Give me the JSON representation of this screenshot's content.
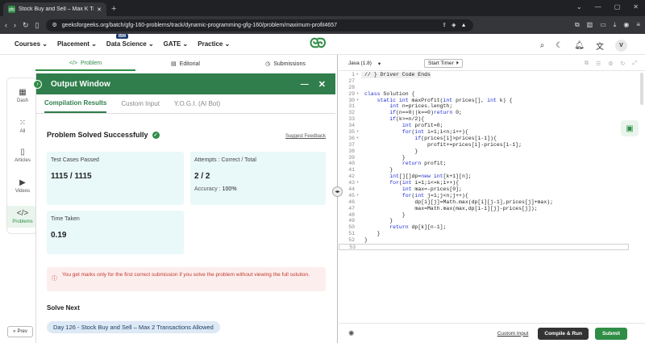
{
  "browser": {
    "tab_title": "Stock Buy and Sell – Max K Tra",
    "new_tab": "+",
    "url": "geeksforgeeks.org/batch/gfg-160-problems/track/dynamic-programming-gfg-160/problem/maximum-profit4657"
  },
  "site": {
    "menu": [
      "Courses",
      "Placement",
      "Data Science",
      "GATE",
      "Practice"
    ],
    "ibm_badge": "IBM",
    "logo": "GG",
    "avatar": "V"
  },
  "problem_tabs": [
    "Problem",
    "Editorial",
    "Submissions"
  ],
  "left_nav": [
    "Dash",
    "All",
    "Articles",
    "Videos",
    "Problems"
  ],
  "prev_label": "Prev",
  "output": {
    "title": "Output Window",
    "tabs": [
      "Compilation Results",
      "Custom Input",
      "Y.O.G.I. (AI Bot)"
    ],
    "status": "Problem Solved Successfully",
    "suggest": "Suggest Feedback",
    "tests_label": "Test Cases Passed",
    "tests_value": "1115 / 1115",
    "attempts_label": "Attempts : Correct / Total",
    "attempts_value": "2 / 2",
    "accuracy_label": "Accuracy :",
    "accuracy_value": "100%",
    "time_label": "Time Taken",
    "time_value": "0.19",
    "warning": "You get marks only for the first correct submission if you solve the problem without viewing the full solution.",
    "solve_next": "Solve Next",
    "next_problem": "Day 126 - Stock Buy and Sell – Max 2 Transactions Allowed"
  },
  "editor": {
    "language": "Java (1.8)",
    "timer": "Start Timer",
    "footer": {
      "custom_input": "Custom Input",
      "compile_run": "Compile & Run",
      "submit": "Submit"
    }
  },
  "code_lines": [
    {
      "n": "1",
      "fold": "▸",
      "t": "// } Driver Code Ends",
      "hl": true,
      "comment": true
    },
    {
      "n": "27",
      "fold": "",
      "t": ""
    },
    {
      "n": "28",
      "fold": "",
      "t": ""
    },
    {
      "n": "29",
      "fold": "▾",
      "t": "class Solution {"
    },
    {
      "n": "30",
      "fold": "▾",
      "t": "    static int maxProfit(int prices[], int k) {"
    },
    {
      "n": "31",
      "fold": "",
      "t": "        int n=prices.length;"
    },
    {
      "n": "32",
      "fold": "",
      "t": "        if(n==0||k==0)return 0;"
    },
    {
      "n": "33",
      "fold": "",
      "t": "        if(k>=n/2){"
    },
    {
      "n": "34",
      "fold": "",
      "t": "            int profit=0;"
    },
    {
      "n": "35",
      "fold": "▾",
      "t": "            for(int i=1;i<n;i++){"
    },
    {
      "n": "36",
      "fold": "▾",
      "t": "                if(prices[i]>prices[i-1]){"
    },
    {
      "n": "37",
      "fold": "",
      "t": "                    profit+=prices[i]-prices[i-1];"
    },
    {
      "n": "38",
      "fold": "",
      "t": "                }"
    },
    {
      "n": "39",
      "fold": "",
      "t": "            }"
    },
    {
      "n": "40",
      "fold": "",
      "t": "            return profit;"
    },
    {
      "n": "41",
      "fold": "",
      "t": "        }"
    },
    {
      "n": "42",
      "fold": "",
      "t": "        int[][]dp=new int[k+1][n];"
    },
    {
      "n": "43",
      "fold": "▾",
      "t": "        for(int i=1;i<=k;i++){"
    },
    {
      "n": "44",
      "fold": "",
      "t": "            int max=-prices[0];"
    },
    {
      "n": "45",
      "fold": "▾",
      "t": "            for(int j=1;j<n;j++){"
    },
    {
      "n": "46",
      "fold": "",
      "t": "                dp[i][j]=Math.max(dp[i][j-1],prices[j]+max);"
    },
    {
      "n": "47",
      "fold": "",
      "t": "                max=Math.max(max,dp[i-1][j]-prices[j]);"
    },
    {
      "n": "48",
      "fold": "",
      "t": "            }"
    },
    {
      "n": "49",
      "fold": "",
      "t": "        }"
    },
    {
      "n": "50",
      "fold": "",
      "t": "        return dp[k][n-1];"
    },
    {
      "n": "51",
      "fold": "",
      "t": "    }"
    },
    {
      "n": "52",
      "fold": "",
      "t": "}"
    },
    {
      "n": "53",
      "fold": "",
      "t": "",
      "cur": true
    }
  ],
  "colors": {
    "brand_green": "#2f8d46",
    "header_green": "#2f7e4c",
    "warn_red": "#c0392b"
  }
}
